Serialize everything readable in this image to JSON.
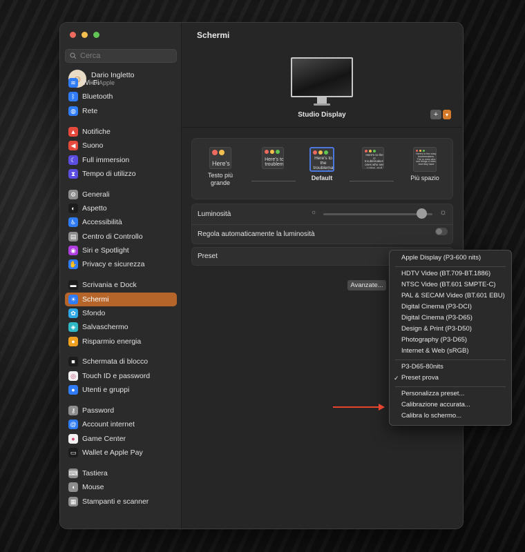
{
  "sidebar": {
    "search_placeholder": "Cerca",
    "account": {
      "name": "Dario Ingletto",
      "subtitle": "ID Apple"
    },
    "items": [
      {
        "label": "Wi-Fi",
        "icon": "wifi-icon",
        "color": "#2f7cf6"
      },
      {
        "label": "Bluetooth",
        "icon": "bluetooth-icon",
        "color": "#2f7cf6"
      },
      {
        "label": "Rete",
        "icon": "globe-icon",
        "color": "#2f7cf6"
      },
      {
        "label": "Notifiche",
        "icon": "bell-icon",
        "color": "#e64a3c"
      },
      {
        "label": "Suono",
        "icon": "speaker-icon",
        "color": "#e64a3c"
      },
      {
        "label": "Full immersion",
        "icon": "moon-icon",
        "color": "#5b4de0"
      },
      {
        "label": "Tempo di utilizzo",
        "icon": "hourglass-icon",
        "color": "#5b4de0"
      },
      {
        "label": "Generali",
        "icon": "gear-icon",
        "color": "#8e8e8e"
      },
      {
        "label": "Aspetto",
        "icon": "appearance-icon",
        "color": "#1c1c1c"
      },
      {
        "label": "Accessibilità",
        "icon": "accessibility-icon",
        "color": "#2f7cf6"
      },
      {
        "label": "Centro di Controllo",
        "icon": "control-center-icon",
        "color": "#8e8e8e"
      },
      {
        "label": "Siri e Spotlight",
        "icon": "siri-icon",
        "color": "#b03de0"
      },
      {
        "label": "Privacy e sicurezza",
        "icon": "hand-icon",
        "color": "#2f7cf6"
      },
      {
        "label": "Scrivania e Dock",
        "icon": "dock-icon",
        "color": "#1c1c1c"
      },
      {
        "label": "Schermi",
        "icon": "sun-icon",
        "color": "#2f7cf6"
      },
      {
        "label": "Sfondo",
        "icon": "wallpaper-icon",
        "color": "#2fa8e6"
      },
      {
        "label": "Salvaschermo",
        "icon": "screensaver-icon",
        "color": "#2fb8c6"
      },
      {
        "label": "Risparmio energia",
        "icon": "bulb-icon",
        "color": "#f0a020"
      },
      {
        "label": "Schermata di blocco",
        "icon": "lock-icon",
        "color": "#1c1c1c"
      },
      {
        "label": "Touch ID e password",
        "icon": "fingerprint-icon",
        "color": "#f2f2f2"
      },
      {
        "label": "Utenti e gruppi",
        "icon": "users-icon",
        "color": "#2f7cf6"
      },
      {
        "label": "Password",
        "icon": "key-icon",
        "color": "#8e8e8e"
      },
      {
        "label": "Account internet",
        "icon": "at-icon",
        "color": "#2f7cf6"
      },
      {
        "label": "Game Center",
        "icon": "game-center-icon",
        "color": "#f2f2f2"
      },
      {
        "label": "Wallet e Apple Pay",
        "icon": "wallet-icon",
        "color": "#1c1c1c"
      },
      {
        "label": "Tastiera",
        "icon": "keyboard-icon",
        "color": "#8e8e8e"
      },
      {
        "label": "Mouse",
        "icon": "mouse-icon",
        "color": "#8e8e8e"
      },
      {
        "label": "Stampanti e scanner",
        "icon": "printer-icon",
        "color": "#8e8e8e"
      }
    ],
    "active": "Schermi",
    "accent": "#b5652a"
  },
  "main": {
    "title": "Schermi",
    "display_name": "Studio Display",
    "add_button": "+",
    "resolution_options": [
      {
        "label": "Testo più grande",
        "preview": "Here's"
      },
      {
        "label": "",
        "preview": "Here's to troublem"
      },
      {
        "label": "Default",
        "preview": "Here's to the troublema ones who"
      },
      {
        "label": "",
        "preview": "Here's to the cr troublemakers. ones who see t rules. And they"
      },
      {
        "label": "Più spazio",
        "preview": "Here's to the crazy troublemakers. The ro ones who see things d rules. And they have"
      }
    ],
    "brightness_label": "Luminosità",
    "brightness_level": 0.9,
    "auto_brightness_label": "Regola automaticamente la luminosità",
    "preset_label": "Preset",
    "advanced_button": "Avanzate..."
  },
  "preset_menu": {
    "groups": [
      [
        "Apple Display (P3-600 nits)"
      ],
      [
        "HDTV Video (BT.709-BT.1886)",
        "NTSC Video (BT.601 SMPTE-C)",
        "PAL & SECAM Video (BT.601 EBU)",
        "Digital Cinema (P3-DCI)",
        "Digital Cinema (P3-D65)",
        "Design & Print (P3-D50)",
        "Photography (P3-D65)",
        "Internet & Web (sRGB)"
      ],
      [
        "P3-D65-80nits",
        "Preset prova"
      ],
      [
        "Personalizza preset...",
        "Calibrazione accurata...",
        "Calibra lo schermo..."
      ]
    ],
    "checked": "Preset prova",
    "checkmark": "✓"
  },
  "annotation_color": "#e8452f"
}
